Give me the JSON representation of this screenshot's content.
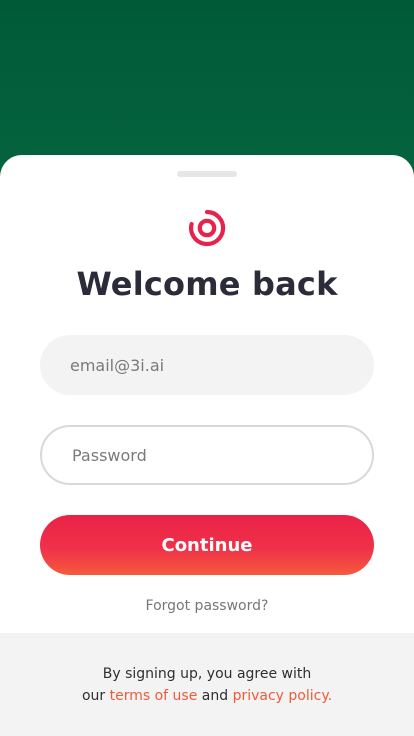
{
  "colors": {
    "header_bg": "#005a38",
    "accent": "#ea2246",
    "accent_end": "#f65a3c",
    "link": "#f05a3a",
    "title": "#2b2b3a"
  },
  "brand": {
    "logo_icon": "swirl-logo-icon"
  },
  "login": {
    "title": "Welcome back",
    "email_placeholder": "email@3i.ai",
    "password_placeholder": "Password",
    "continue_label": "Continue",
    "forgot_label": "Forgot password?"
  },
  "footer": {
    "line1": "By signing up, you agree with",
    "prefix": "our",
    "terms_link": "terms of use",
    "and": "and",
    "privacy_link": "privacy policy."
  }
}
